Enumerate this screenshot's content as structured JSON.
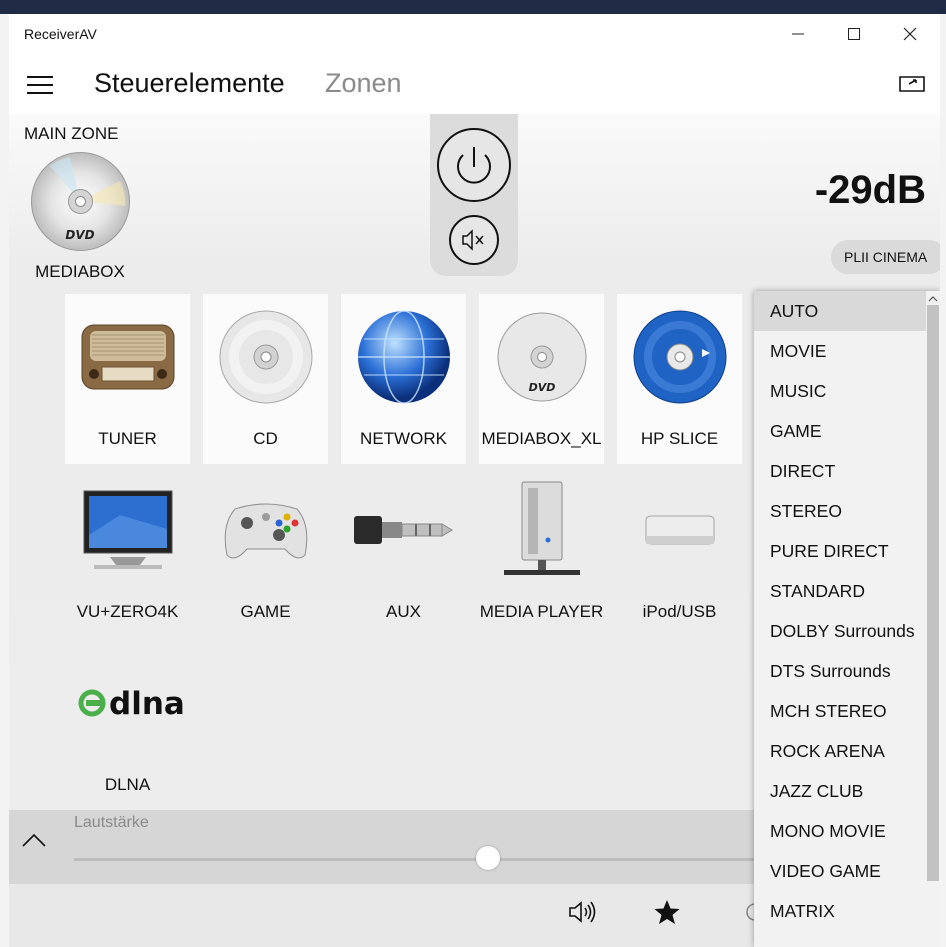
{
  "app": {
    "title": "ReceiverAV"
  },
  "header": {
    "tabs": [
      {
        "label": "Steuerelemente",
        "active": true
      },
      {
        "label": "Zonen",
        "active": false
      }
    ]
  },
  "zone": {
    "name": "MAIN ZONE",
    "source": "MEDIABOX",
    "volume": "-29dB",
    "surround_mode": "PLII CINEMA"
  },
  "sources": [
    {
      "label": "TUNER",
      "icon": "radio-icon"
    },
    {
      "label": "CD",
      "icon": "cd-icon"
    },
    {
      "label": "NETWORK",
      "icon": "globe-icon"
    },
    {
      "label": "MEDIABOX_XL",
      "icon": "dvd-icon"
    },
    {
      "label": "HP SLICE",
      "icon": "bluray-icon"
    },
    {
      "label": "VU+ZERO4K",
      "icon": "tv-icon"
    },
    {
      "label": "GAME",
      "icon": "gamepad-icon"
    },
    {
      "label": "AUX",
      "icon": "audio-jack-icon"
    },
    {
      "label": "MEDIA PLAYER",
      "icon": "media-server-icon"
    },
    {
      "label": "iPod/USB",
      "icon": "ipod-dock-icon"
    },
    {
      "label": "DLNA",
      "icon": "dlna-logo",
      "logo_text": "dlna"
    }
  ],
  "volume_bar": {
    "label": "Lautstärke",
    "level": 0.6
  },
  "dropdown": {
    "items": [
      "AUTO",
      "MOVIE",
      "MUSIC",
      "GAME",
      "DIRECT",
      "STEREO",
      "PURE DIRECT",
      "STANDARD",
      "DOLBY Surrounds",
      "DTS Surrounds",
      "MCH STEREO",
      "ROCK ARENA",
      "JAZZ CLUB",
      "MONO MOVIE",
      "VIDEO GAME",
      "MATRIX"
    ],
    "selected": "AUTO"
  },
  "colors": {
    "accent_blue": "#1f63c4",
    "dlna_green": "#4bb04b",
    "panel_gray": "#dcdcdc"
  }
}
